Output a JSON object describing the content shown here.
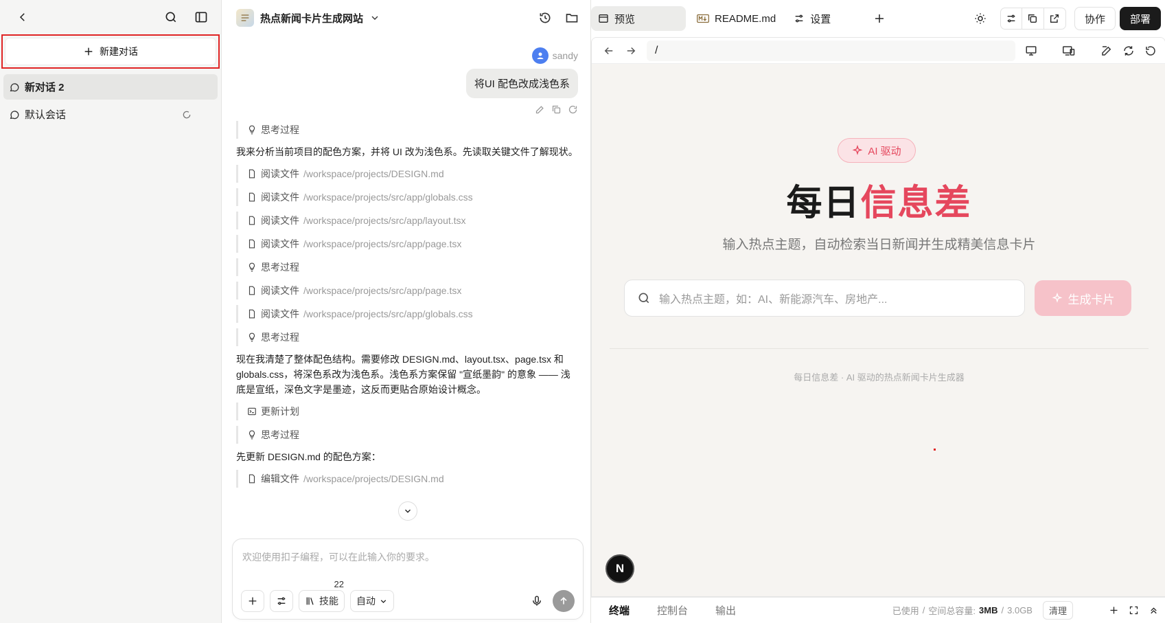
{
  "sidebar": {
    "new_chat_label": "新建对话",
    "conversations": [
      {
        "label": "新对话 2",
        "active": true
      },
      {
        "label": "默认会话",
        "active": false
      }
    ]
  },
  "chat": {
    "project_title": "热点新闻卡片生成网站",
    "user_name": "sandy",
    "user_message": "将UI 配色改成浅色系",
    "steps": [
      {
        "kind": "think",
        "label": "思考过程"
      },
      {
        "kind": "text",
        "text": "我来分析当前项目的配色方案，并将 UI 改为浅色系。先读取关键文件了解现状。"
      },
      {
        "kind": "file",
        "label": "阅读文件",
        "path": "/workspace/projects/DESIGN.md"
      },
      {
        "kind": "file",
        "label": "阅读文件",
        "path": "/workspace/projects/src/app/globals.css"
      },
      {
        "kind": "file",
        "label": "阅读文件",
        "path": "/workspace/projects/src/app/layout.tsx"
      },
      {
        "kind": "file",
        "label": "阅读文件",
        "path": "/workspace/projects/src/app/page.tsx"
      },
      {
        "kind": "think",
        "label": "思考过程"
      },
      {
        "kind": "file",
        "label": "阅读文件",
        "path": "/workspace/projects/src/app/page.tsx"
      },
      {
        "kind": "file",
        "label": "阅读文件",
        "path": "/workspace/projects/src/app/globals.css"
      },
      {
        "kind": "think",
        "label": "思考过程"
      },
      {
        "kind": "text",
        "text": "现在我清楚了整体配色结构。需要修改 DESIGN.md、layout.tsx、page.tsx 和 globals.css，将深色系改为浅色系。浅色系方案保留 \"宣纸墨韵\" 的意象 —— 浅底是宣纸，深色文字是墨迹，这反而更贴合原始设计概念。"
      },
      {
        "kind": "plan",
        "label": "更新计划"
      },
      {
        "kind": "think",
        "label": "思考过程"
      },
      {
        "kind": "text",
        "text": "先更新 DESIGN.md 的配色方案："
      },
      {
        "kind": "edit",
        "label": "编辑文件",
        "path": "/workspace/projects/DESIGN.md"
      }
    ],
    "composer": {
      "placeholder": "欢迎使用扣子编程，可以在此输入你的要求。",
      "skills_label": "技能",
      "skills_count": "22",
      "mode_label": "自动"
    }
  },
  "preview": {
    "tabs": [
      {
        "label": "预览",
        "active": true
      },
      {
        "label": "README.md",
        "active": false
      },
      {
        "label": "设置",
        "active": false
      }
    ],
    "collab_label": "协作",
    "deploy_label": "部署",
    "url": "/",
    "site": {
      "badge": "AI 驱动",
      "hero_a": "每日",
      "hero_b": "信息差",
      "subtitle": "输入热点主题，自动检索当日新闻并生成精美信息卡片",
      "search_placeholder": "输入热点主题，如：AI、新能源汽车、房地产...",
      "generate_label": "生成卡片",
      "footer": "每日信息差 · AI 驱动的热点新闻卡片生成器",
      "n_badge": "N"
    },
    "bottom": {
      "tabs": [
        "终端",
        "控制台",
        "输出"
      ],
      "used_label": "已使用",
      "sep": "/",
      "total_label": "空间总容量:",
      "used": "3MB",
      "total": "3.0GB",
      "clear_label": "清理"
    }
  },
  "colors": {
    "accent_red": "#e5475d",
    "highlight_border": "#e02424",
    "dark_button": "#1b1b1b"
  }
}
